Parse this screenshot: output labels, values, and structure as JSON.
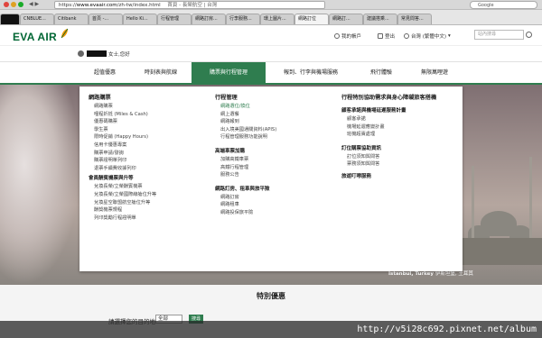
{
  "browser": {
    "url_prefix": "https://",
    "url_domain": "www.evaair.com",
    "url_path": "/zh-tw/index.html",
    "page_title_in_bar": "首頁 - 長榮航空 | 台灣",
    "tabs": [
      "",
      "CNBLUE...",
      "Citibank",
      "首頁 -...",
      "Hello Ki...",
      "行程管理",
      "網路訂房...",
      "行李服務...",
      "環上圖片...",
      "網路訂位",
      "網路訂...",
      "建議搭乘...",
      "常見問答..."
    ],
    "search_placeholder": "Google"
  },
  "header": {
    "logo_text": "EVA AIR",
    "my_account": "我的帳戶",
    "logout": "登出",
    "language": "台灣 (繁體中文)",
    "site_search_placeholder": "站內搜尋"
  },
  "greeting": {
    "text": "女士,您好"
  },
  "nav": {
    "items": [
      "超值優惠",
      "時刻表與航線",
      "購票與行程管理",
      "報到、行李與機場服務",
      "飛行體驗",
      "無限萬哩遊"
    ]
  },
  "panel": {
    "col1": {
      "heading1": "網路購票",
      "links1": [
        "網路購票",
        "哩程折抵 (Miles & Cash)",
        "優惠碼購票",
        "學生票",
        "限時促銷 (Happy Hours)",
        "信用卡優惠專案",
        "購票申請/發詢",
        "購票證明單列印",
        "退票手續費收據列印"
      ],
      "heading2": "會員酬賓機票與升等",
      "links2": [
        "兌換長榮/立榮酬賓機票",
        "兌換長榮/立榮國際線艙位升等",
        "兌換星空聯盟航空艙位升等",
        "酬獎機票規程",
        "列印獎勵行程證明單"
      ]
    },
    "col2": {
      "heading1": "行程管理",
      "links1": [
        "網路選位/換位",
        "網上選餐",
        "網路報到",
        "出入境美國通關資料(APIS)",
        "行程管理服務功能說明"
      ],
      "heading2": "高端車票加購",
      "links2": [
        "加購高鐵車票",
        "高鐵行程管理",
        "服務公告"
      ],
      "heading3": "網路訂房、租車與旅平險",
      "links3": [
        "網路訂房",
        "網路租車",
        "網路投保旅平險"
      ]
    },
    "col3": {
      "heading1": "行程特別協助需求與身心障礙旅客搭機",
      "heading2": "顧客承諾與機場延遲服務計畫",
      "links2": [
        "顧客承諾",
        "機場延遲應變計畫",
        "班機超賣處理"
      ],
      "heading3": "訂位購票協助資訊",
      "links3": [
        "訂位須知與問答",
        "票務須知與問答"
      ],
      "heading4": "旅遊叮嚀服務"
    }
  },
  "hero": {
    "caption_en": "Istanbul, Turkey",
    "caption_zh": "伊斯坦堡, 土耳其"
  },
  "special": {
    "title": "特別優惠",
    "dest_label": "請選擇您的目的地",
    "dest_value": "全部",
    "go_button": "搜尋"
  },
  "watermark": {
    "text": "http://v5i28c692.pixnet.net/album"
  },
  "colors": {
    "brand_green": "#2f7d4f",
    "logo_green": "#006633"
  }
}
